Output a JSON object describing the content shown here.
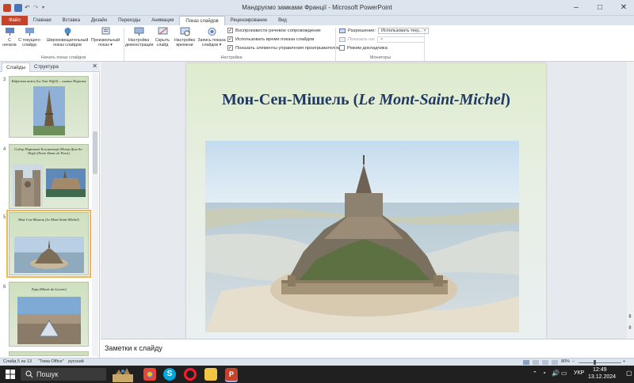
{
  "window": {
    "title": "Мандруємо замками Франції - Microsoft PowerPoint",
    "controls": {
      "minimize": "–",
      "maximize": "□",
      "close": "✕"
    }
  },
  "tabs": [
    {
      "label": "Файл"
    },
    {
      "label": "Главная"
    },
    {
      "label": "Вставка"
    },
    {
      "label": "Дизайн"
    },
    {
      "label": "Переходы"
    },
    {
      "label": "Анимация"
    },
    {
      "label": "Показ слайдов",
      "active": true
    },
    {
      "label": "Рецензирование"
    },
    {
      "label": "Вид"
    }
  ],
  "ribbon": {
    "group_start": {
      "label": "Начать показ слайдов",
      "buttons": [
        {
          "line1": "С",
          "line2": "начала"
        },
        {
          "line1": "С текущего",
          "line2": "слайда"
        },
        {
          "line1": "Широковещательный",
          "line2": "показ слайдов"
        },
        {
          "line1": "Произвольный",
          "line2": "показ ▾"
        }
      ]
    },
    "group_setup": {
      "label": "Настройка",
      "buttons": [
        {
          "line1": "Настройка",
          "line2": "демонстрации"
        },
        {
          "line1": "Скрыть",
          "line2": "слайд"
        },
        {
          "line1": "Настройка",
          "line2": "времени"
        },
        {
          "line1": "Запись показа",
          "line2": "слайдов ▾"
        }
      ],
      "checkboxes": [
        {
          "label": "Воспроизвести речевое сопровождение",
          "checked": "✓"
        },
        {
          "label": "Использовать время показа слайдов",
          "checked": "✓"
        },
        {
          "label": "Показать элементы управления проигрывателем",
          "checked": "✓"
        }
      ]
    },
    "group_monitors": {
      "label": "Мониторы",
      "resolution_label": "Разрешение:",
      "resolution_value": "Использовать теку...",
      "show_on_label": "Показать на:",
      "presenter_view": "Режим докладчика"
    }
  },
  "left_pane": {
    "tab_slides": "Слайды",
    "tab_outline": "Структура",
    "close": "✕",
    "thumbnails": [
      {
        "num": "3",
        "title": "Ейфелева вежа (La Tour Eiffel) – символ Парижа"
      },
      {
        "num": "4",
        "title": "Собор Паризької Богоматері (Нотр-Дам-де-Парі) (Notre Dame de Paris)"
      },
      {
        "num": "5",
        "title": "Мон-Сен-Мішель (Le Mont-Saint-Michel)",
        "selected": true
      },
      {
        "num": "6",
        "title": "Лувр (Musée du Louvre)"
      }
    ]
  },
  "slide": {
    "title_plain": "Мон-Сен-Мішель (",
    "title_italic": "Le Mont-Saint-Michel",
    "title_end": ")"
  },
  "notes": {
    "placeholder": "Заметки к слайду"
  },
  "status": {
    "slide_info": "Слайд 5 из 13",
    "theme": "\"Тема Office\"",
    "language": "русский",
    "zoom": "80%"
  },
  "taskbar": {
    "search": "Пошук",
    "language": "УКР",
    "time": "12:49",
    "date": "13.12.2024"
  }
}
